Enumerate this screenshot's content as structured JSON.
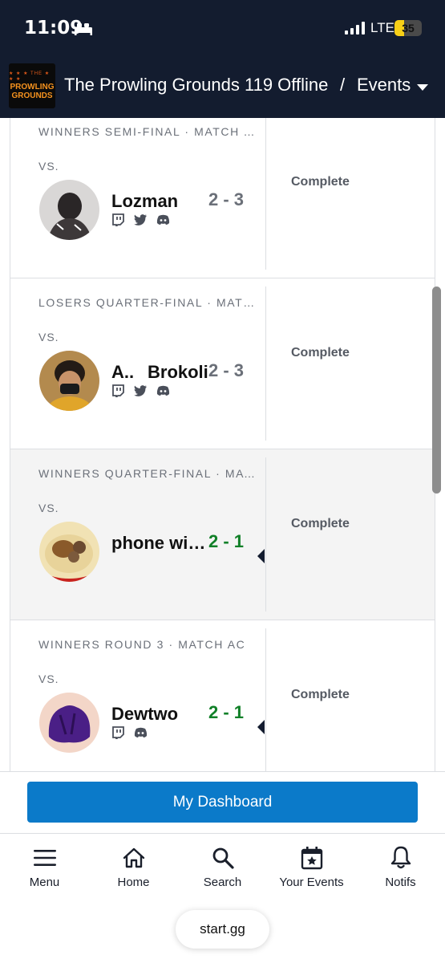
{
  "status_bar": {
    "time": "11:09",
    "network": "LTE",
    "battery": "35",
    "battery_level": 0.35,
    "icons": [
      "bed-icon",
      "signal-icon"
    ]
  },
  "header": {
    "logo_lines": [
      "PROWLING",
      "GROUNDS"
    ],
    "logo_top": "THE",
    "title": "The Prowling Grounds 119 Offline",
    "separator": "/",
    "section": "Events",
    "icons": [
      "chevron-down-icon"
    ]
  },
  "matches": [
    {
      "round": "WINNERS SEMI-FINAL · MATCH AE",
      "vs": "VS.",
      "player": "Lozman",
      "score": "2 - 3",
      "status": "Complete",
      "socials": [
        "twitch-icon",
        "twitter-icon",
        "discord-icon"
      ],
      "win": false
    },
    {
      "round": "LOSERS QUARTER-FINAL · MATCH AD",
      "vs": "VS.",
      "player_prefix": "A..",
      "player": "Brokoli",
      "score": "2 - 3",
      "status": "Complete",
      "socials": [
        "twitch-icon",
        "twitter-icon",
        "discord-icon"
      ],
      "win": false
    },
    {
      "round": "WINNERS QUARTER-FINAL · MATCH AB",
      "vs": "VS.",
      "player": "phone wizard",
      "score": "2 - 1",
      "status": "Complete",
      "socials": [],
      "win": true
    },
    {
      "round": "WINNERS ROUND 3 · MATCH AC",
      "vs": "VS.",
      "player": "Dewtwo",
      "score": "2 - 1",
      "status": "Complete",
      "socials": [
        "twitch-icon",
        "discord-icon"
      ],
      "win": true
    }
  ],
  "dashboard_button": "My Dashboard",
  "bottom_nav": [
    {
      "label": "Menu",
      "icon": "menu-icon"
    },
    {
      "label": "Home",
      "icon": "home-icon"
    },
    {
      "label": "Search",
      "icon": "search-icon"
    },
    {
      "label": "Your Events",
      "icon": "calendar-star-icon"
    },
    {
      "label": "Notifs",
      "icon": "bell-icon"
    }
  ],
  "browser": {
    "url": "start.gg"
  },
  "colors": {
    "header_bg": "#131c2f",
    "win_score": "#118028",
    "accent": "#0b7ac9",
    "battery": "#f7cf16"
  }
}
